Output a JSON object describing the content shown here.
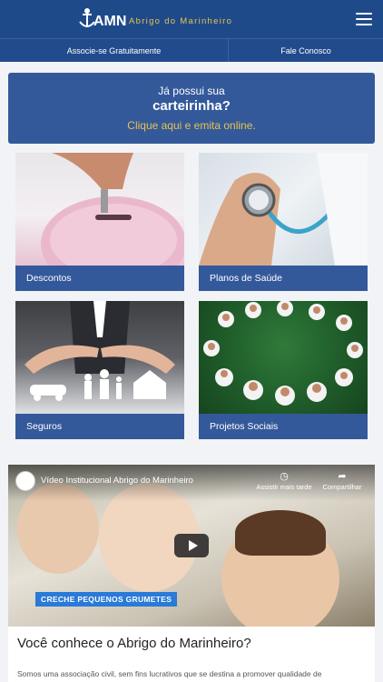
{
  "header": {
    "brand_mark": "AMN",
    "brand_name": "Abrigo do Marinheiro",
    "menu_icon": "hamburger-icon",
    "accent": "#e7c24b",
    "bg": "#1f4a8a"
  },
  "subnav": {
    "associate": "Associe-se Gratuitamente",
    "contact": "Fale Conosco"
  },
  "card_banner": {
    "line1": "Já possui sua",
    "line2": "carteirinha?",
    "link": "Clique aqui e emita online."
  },
  "tiles": [
    {
      "label": "Descontos"
    },
    {
      "label": "Planos de Saúde"
    },
    {
      "label": "Seguros"
    },
    {
      "label": "Projetos Sociais"
    }
  ],
  "video": {
    "title": "Vídeo Institucional Abrigo do Marinheiro",
    "watch_later": "Assistir mais tarde",
    "share": "Compartilhar",
    "caption": "CRECHE PEQUENOS GRUMETES"
  },
  "about": {
    "heading": "Você conhece o Abrigo do Marinheiro?",
    "text": "Somos uma associação civil, sem fins lucrativos que se destina a promover qualidade de"
  }
}
